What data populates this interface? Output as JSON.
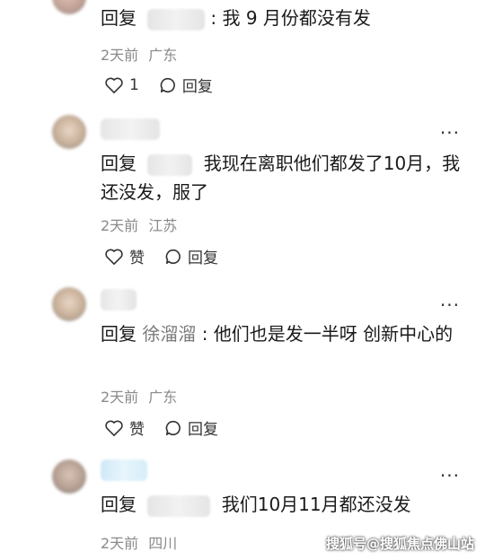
{
  "comments": [
    {
      "reply_label": "回复",
      "mention": "",
      "text": "我 9 月份都没有发",
      "time": "2天前",
      "location": "广东",
      "like_count": "1",
      "reply_action": "回复"
    },
    {
      "reply_label": "回复",
      "mention": "",
      "text": "我现在离职他们都发了10月，我还没发，服了",
      "time": "2天前",
      "location": "江苏",
      "like_label": "赞",
      "reply_action": "回复"
    },
    {
      "reply_label": "回复",
      "mention": "徐溜溜",
      "text": "他们也是发一半呀 创新中心的",
      "time": "2天前",
      "location": "广东",
      "like_label": "赞",
      "reply_action": "回复"
    },
    {
      "reply_label": "回复",
      "mention": "",
      "text": "我们10月11月都还没发",
      "time": "2天前",
      "location": "四川"
    }
  ],
  "more_icon": "more-horizontal-icon",
  "like_icon": "heart-icon",
  "reply_icon": "speech-bubble-icon",
  "watermark": "搜狐号@搜狐焦点佛山站"
}
